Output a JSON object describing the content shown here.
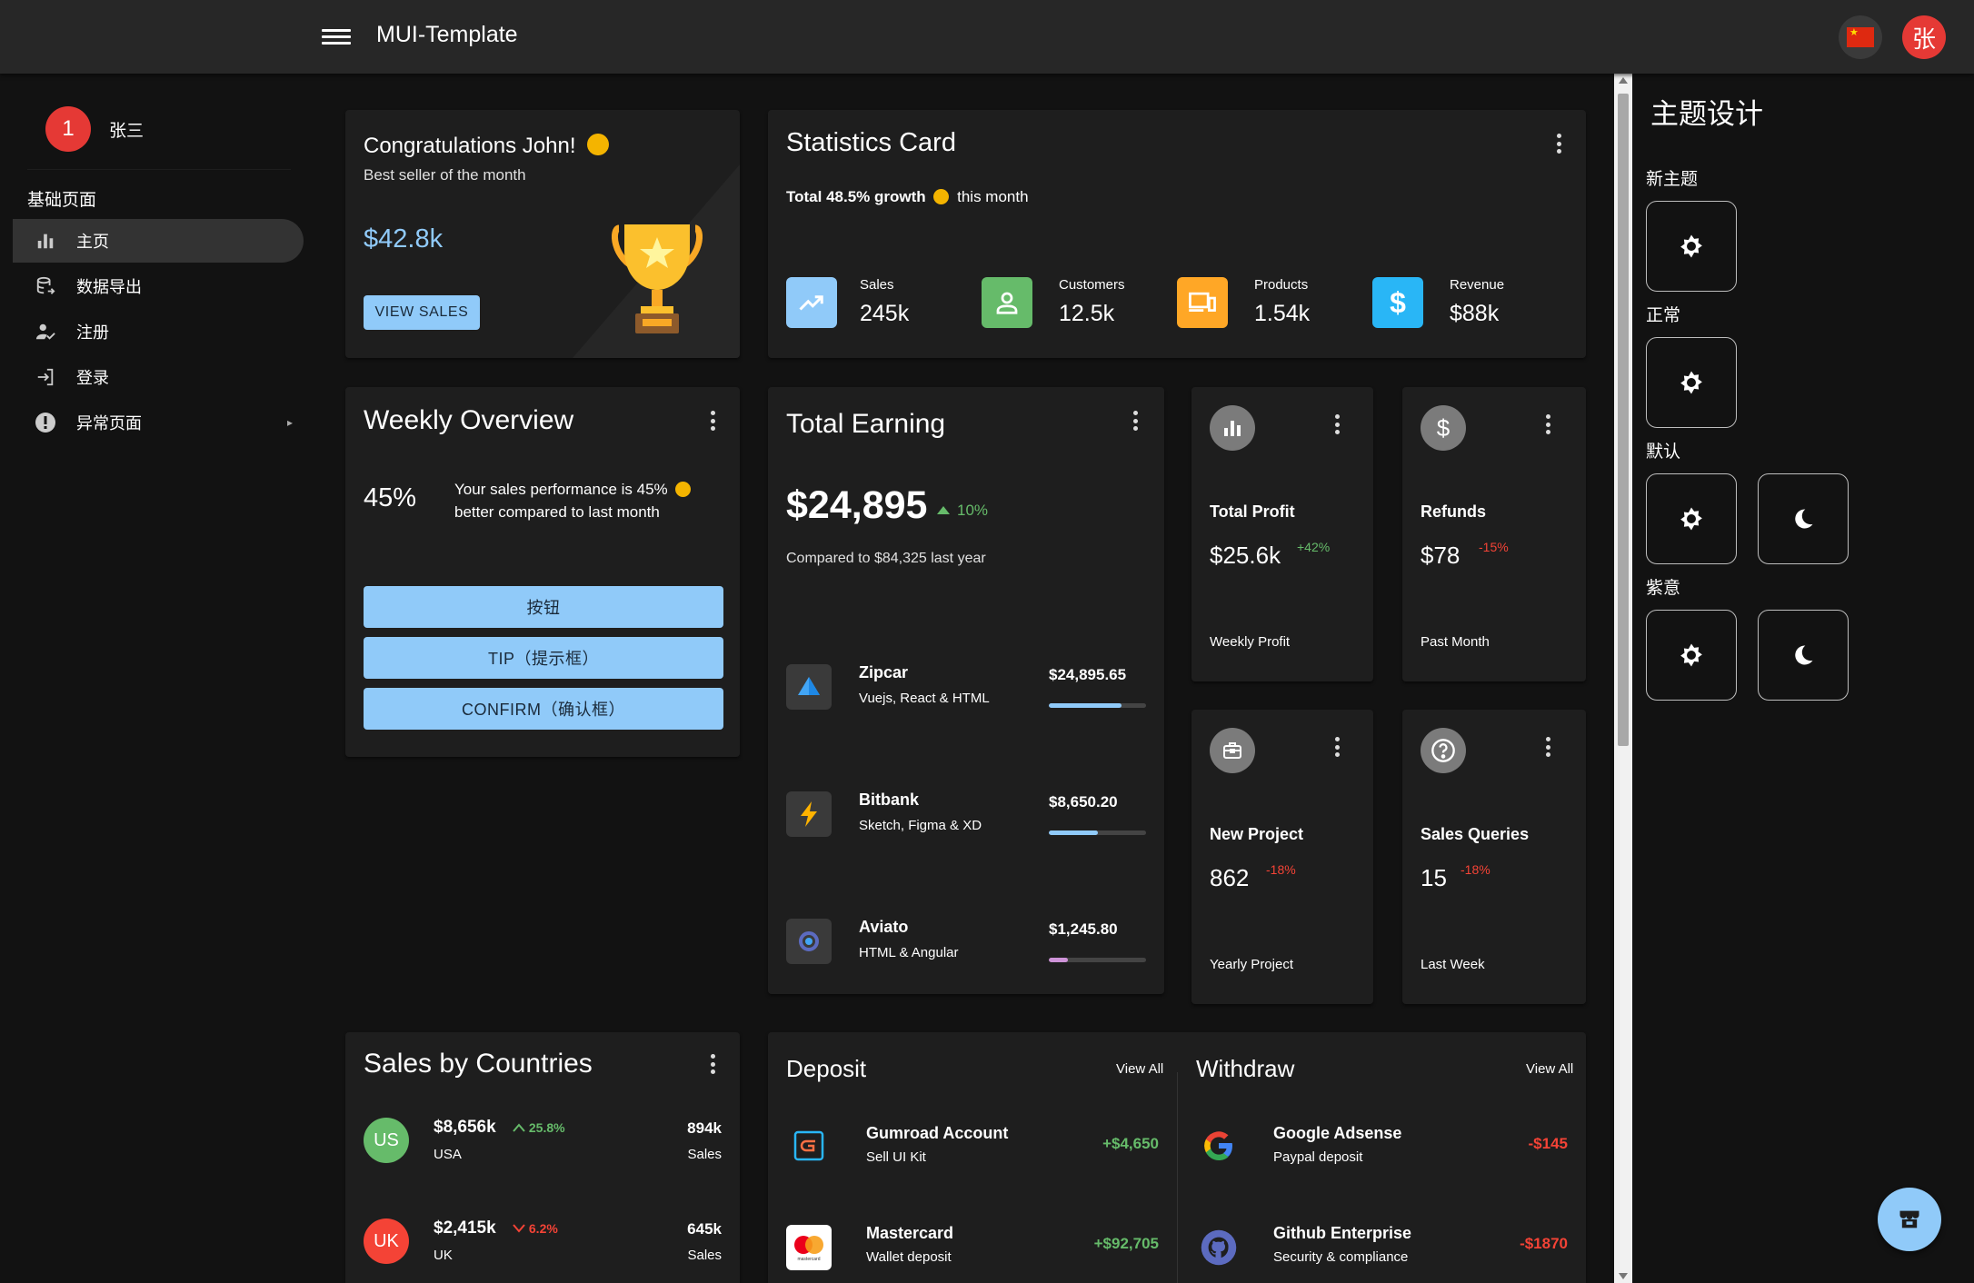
{
  "header": {
    "title": "MUI-Template",
    "user_initial": "张"
  },
  "sidebar": {
    "avatar": "1",
    "user_name": "张三",
    "section": "基础页面",
    "items": [
      {
        "label": "主页",
        "icon": "bar-chart-icon"
      },
      {
        "label": "数据导出",
        "icon": "database-export-icon"
      },
      {
        "label": "注册",
        "icon": "user-check-icon"
      },
      {
        "label": "登录",
        "icon": "login-icon"
      },
      {
        "label": "异常页面",
        "icon": "error-icon"
      }
    ]
  },
  "congrats": {
    "title": "Congratulations John!",
    "subtitle": "Best seller of the month",
    "amount": "$42.8k",
    "button": "VIEW SALES"
  },
  "statistics": {
    "title": "Statistics Card",
    "growth_bold": "Total 48.5% growth",
    "growth_rest": "this month",
    "items": [
      {
        "label": "Sales",
        "value": "245k",
        "color": "#90caf9",
        "icon": "trending-up-icon"
      },
      {
        "label": "Customers",
        "value": "12.5k",
        "color": "#66bb6a",
        "icon": "account-icon"
      },
      {
        "label": "Products",
        "value": "1.54k",
        "color": "#ffa726",
        "icon": "devices-icon"
      },
      {
        "label": "Revenue",
        "value": "$88k",
        "color": "#29b6f6",
        "icon": "dollar-icon"
      }
    ]
  },
  "weekly": {
    "title": "Weekly Overview",
    "percent": "45%",
    "text_line1": "Your sales performance is 45%",
    "text_line2": "better compared to last month",
    "buttons": [
      "按钮",
      "TIP（提示框）",
      "CONFIRM（确认框）"
    ]
  },
  "earning": {
    "title": "Total Earning",
    "amount": "$24,895",
    "change": "10%",
    "compare": "Compared to $84,325 last year",
    "items": [
      {
        "name": "Zipcar",
        "desc": "Vuejs, React & HTML",
        "amount": "$24,895.65",
        "progress": 0.75,
        "color": "#90caf9"
      },
      {
        "name": "Bitbank",
        "desc": "Sketch, Figma & XD",
        "amount": "$8,650.20",
        "progress": 0.5,
        "color": "#90caf9"
      },
      {
        "name": "Aviato",
        "desc": "HTML & Angular",
        "amount": "$1,245.80",
        "progress": 0.2,
        "color": "#ce93d8"
      }
    ]
  },
  "mini_cards": [
    {
      "title": "Total Profit",
      "value": "$25.6k",
      "change": "+42%",
      "change_color": "#66bb6a",
      "footer": "Weekly Profit",
      "icon": "bar-chart-icon"
    },
    {
      "title": "Refunds",
      "value": "$78",
      "change": "-15%",
      "change_color": "#f44336",
      "footer": "Past Month",
      "icon": "dollar-icon"
    },
    {
      "title": "New Project",
      "value": "862",
      "change": "-18%",
      "change_color": "#f44336",
      "footer": "Yearly Project",
      "icon": "briefcase-icon"
    },
    {
      "title": "Sales Queries",
      "value": "15",
      "change": "-18%",
      "change_color": "#f44336",
      "footer": "Last Week",
      "icon": "help-circle-icon"
    }
  ],
  "countries": {
    "title": "Sales by Countries",
    "items": [
      {
        "code": "US",
        "amount": "$8,656k",
        "trend": "up",
        "change": "25.8%",
        "name": "USA",
        "sales": "894k",
        "sales_label": "Sales",
        "color": "#66bb6a",
        "change_color": "#66bb6a"
      },
      {
        "code": "UK",
        "amount": "$2,415k",
        "trend": "down",
        "change": "6.2%",
        "name": "UK",
        "sales": "645k",
        "sales_label": "Sales",
        "color": "#f44336",
        "change_color": "#f44336"
      }
    ]
  },
  "deposit": {
    "title": "Deposit",
    "view_all": "View All",
    "items": [
      {
        "name": "Gumroad Account",
        "desc": "Sell UI Kit",
        "amount": "+$4,650"
      },
      {
        "name": "Mastercard",
        "desc": "Wallet deposit",
        "amount": "+$92,705",
        "logo_text": "mastercard"
      }
    ]
  },
  "withdraw": {
    "title": "Withdraw",
    "view_all": "View All",
    "items": [
      {
        "name": "Google Adsense",
        "desc": "Paypal deposit",
        "amount": "-$145"
      },
      {
        "name": "Github Enterprise",
        "desc": "Security & compliance",
        "amount": "-$1870"
      }
    ]
  },
  "theme_panel": {
    "title": "主题设计",
    "groups": [
      {
        "label": "新主题",
        "modes": [
          "light"
        ]
      },
      {
        "label": "正常",
        "modes": [
          "light"
        ]
      },
      {
        "label": "默认",
        "modes": [
          "light",
          "dark"
        ]
      },
      {
        "label": "紫意",
        "modes": [
          "light",
          "dark"
        ]
      }
    ]
  }
}
